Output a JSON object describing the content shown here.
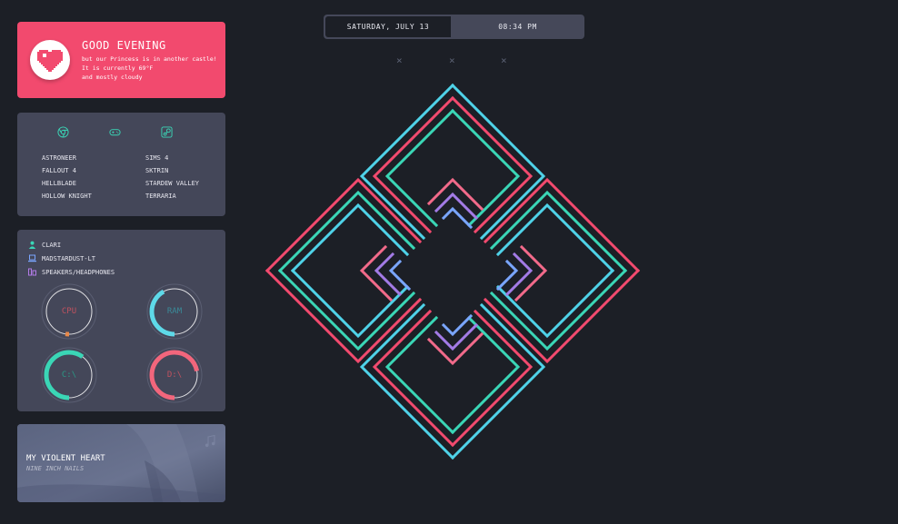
{
  "greeting": {
    "title": "GOOD EVENING",
    "line1": "but our Princess is in another castle!",
    "line2": "It is currently 69°F",
    "line3": "and mostly cloudy"
  },
  "games": {
    "icons": [
      "chrome-icon",
      "gamepad-icon",
      "steam-icon"
    ],
    "left": [
      "ASTRONEER",
      "FALLOUT 4",
      "HELLBLADE",
      "HOLLOW KNIGHT"
    ],
    "right": [
      "SIMS 4",
      "SKTRIN",
      "STARDEW VALLEY",
      "TERRARIA"
    ]
  },
  "system": {
    "user": "CLARI",
    "host": "MADSTARDUST-LT",
    "audio": "SPEAKERS/HEADPHONES",
    "gauges": [
      {
        "label": "CPU",
        "value": 0.02,
        "color": "#e8894a",
        "text_color": "#c0525f"
      },
      {
        "label": "RAM",
        "value": 0.42,
        "color": "#5ed9e8",
        "text_color": "#3a8a98"
      },
      {
        "label": "C:\\",
        "value": 0.6,
        "color": "#3ad6b6",
        "text_color": "#2a9a86"
      },
      {
        "label": "D:\\",
        "value": 0.72,
        "color": "#f2667c",
        "text_color": "#c0525f"
      }
    ]
  },
  "music": {
    "song": "MY VIOLENT HEART",
    "artist": "NINE INCH NAILS",
    "icon": "music-note-icon"
  },
  "topbar": {
    "date": "SATURDAY, JULY 13",
    "time": "08:34 PM"
  },
  "decor": {
    "marks": [
      "×",
      "×",
      "×"
    ],
    "colors": {
      "pink": "#f24a6e",
      "teal": "#3ad6b6",
      "cyan": "#4fd2e8",
      "purple": "#a37be6"
    }
  }
}
